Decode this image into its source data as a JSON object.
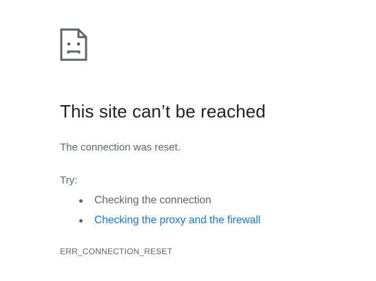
{
  "error_page": {
    "icon": "sad-page-icon",
    "title": "This site can’t be reached",
    "message": "The connection was reset.",
    "try_label": "Try:",
    "suggestions": [
      {
        "text": "Checking the connection",
        "is_link": false
      },
      {
        "text": "Checking the proxy and the firewall",
        "is_link": true
      }
    ],
    "error_code": "ERR_CONNECTION_RESET"
  },
  "colors": {
    "title": "#202124",
    "body_text": "#5f6368",
    "link": "#1a73e8",
    "background": "#ffffff"
  }
}
